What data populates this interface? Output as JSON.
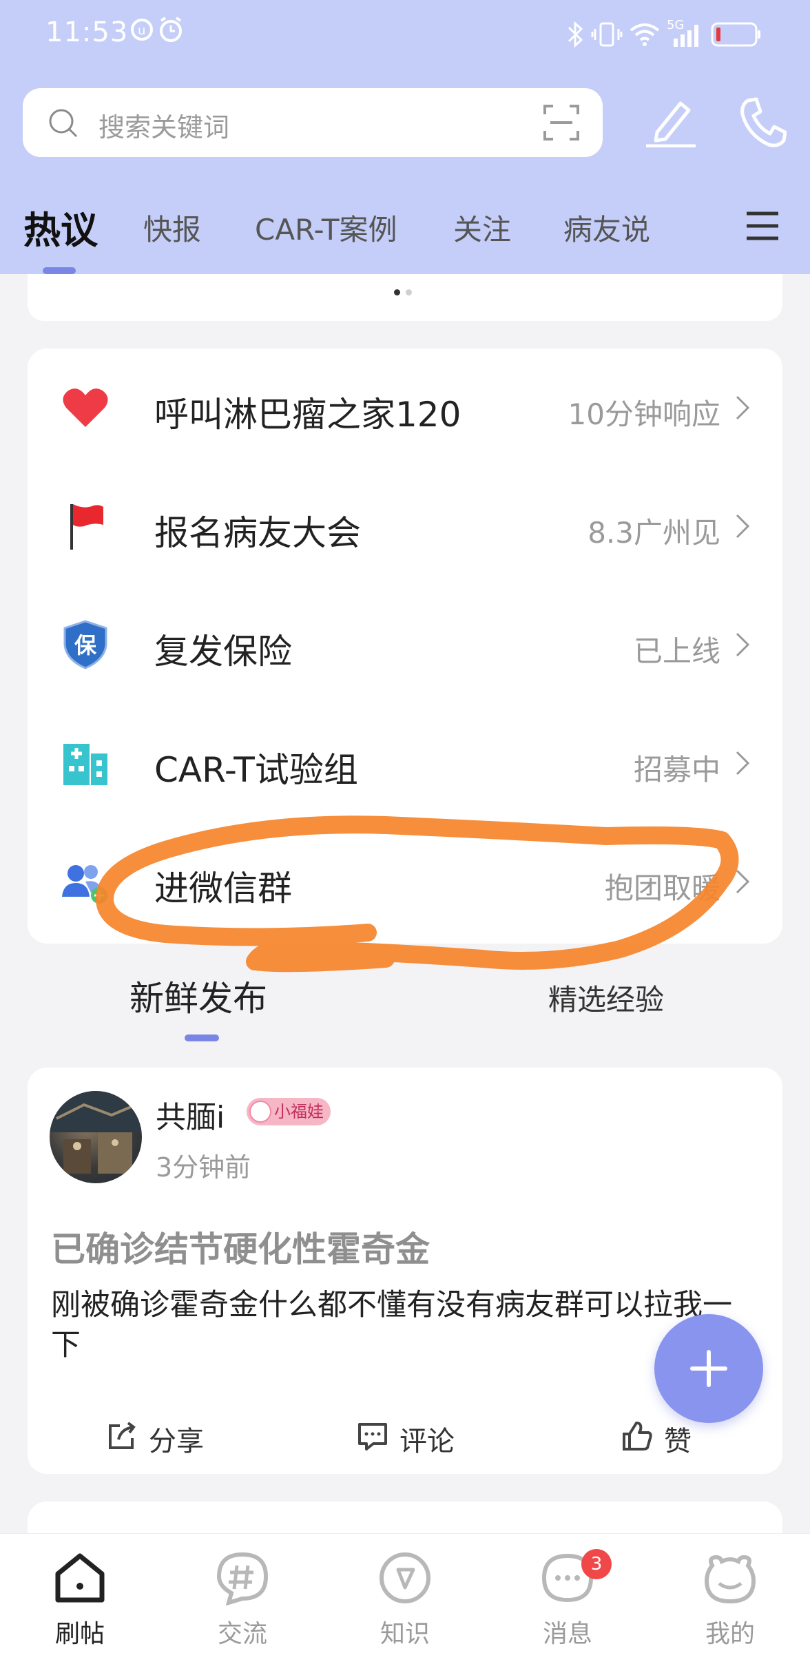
{
  "status_bar": {
    "time": "11:53",
    "network": "5G"
  },
  "search": {
    "placeholder": "搜索关键词"
  },
  "top_tabs": [
    "热议",
    "快报",
    "CAR-T案例",
    "关注",
    "病友说"
  ],
  "services": [
    {
      "label": "呼叫淋巴瘤之家120",
      "sub": "10分钟响应",
      "icon": "heart-icon"
    },
    {
      "label": "报名病友大会",
      "sub": "8.3广州见",
      "icon": "flag-icon"
    },
    {
      "label": "复发保险",
      "sub": "已上线",
      "icon": "shield-icon",
      "icon_text": "保"
    },
    {
      "label": "CAR-T试验组",
      "sub": "招募中",
      "icon": "hospital-icon"
    },
    {
      "label": "进微信群",
      "sub": "抱团取暖",
      "icon": "group-add-icon"
    }
  ],
  "section_tabs": {
    "left": "新鲜发布",
    "right": "精选经验"
  },
  "post": {
    "author": "共腼i",
    "badge": "小福娃",
    "time": "3分钟前",
    "title": "已确诊结节硬化性霍奇金",
    "body": "刚被确诊霍奇金什么都不懂有没有病友群可以拉我一下",
    "actions": {
      "share": "分享",
      "comment": "评论",
      "like": "赞"
    }
  },
  "bottom_nav": [
    {
      "label": "刷帖",
      "icon": "home-icon",
      "active": true
    },
    {
      "label": "交流",
      "icon": "hashtag-icon"
    },
    {
      "label": "知识",
      "icon": "compass-icon"
    },
    {
      "label": "消息",
      "icon": "message-icon",
      "badge": "3"
    },
    {
      "label": "我的",
      "icon": "profile-icon"
    }
  ],
  "colors": {
    "header_bg": "#c5cef8",
    "accent": "#7a86e6",
    "fab": "#8894ee",
    "annotation": "#f5842a"
  }
}
